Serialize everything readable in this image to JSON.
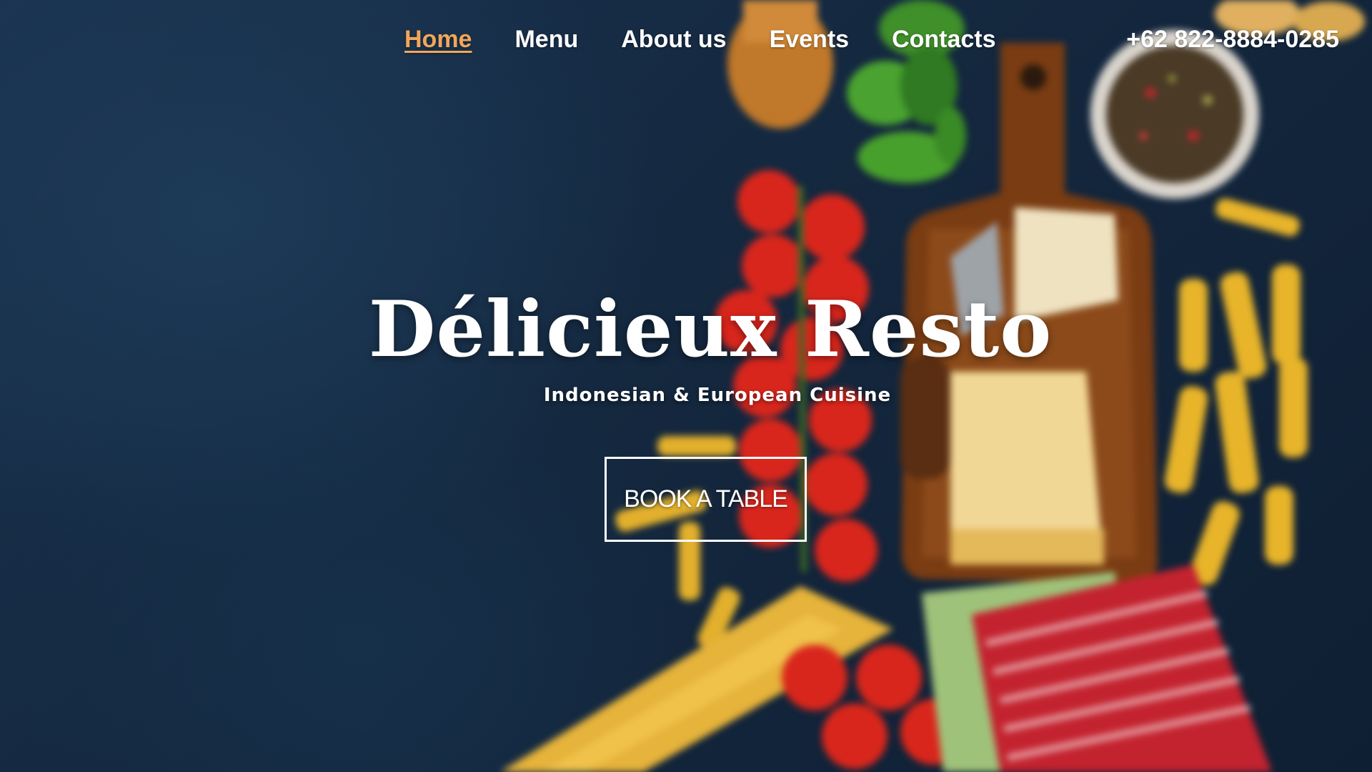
{
  "nav": {
    "items": [
      {
        "label": "Home",
        "active": true
      },
      {
        "label": "Menu",
        "active": false
      },
      {
        "label": "About us",
        "active": false
      },
      {
        "label": "Events",
        "active": false
      },
      {
        "label": "Contacts",
        "active": false
      }
    ],
    "phone": "+62 822-8884-0285"
  },
  "hero": {
    "title": "Délicieux Resto",
    "subtitle": "Indonesian & European Cuisine",
    "cta_label": "BOOK A TABLE"
  },
  "colors": {
    "active_nav": "#f2a65a",
    "background": "#14283f",
    "text": "#ffffff"
  },
  "icons": {
    "background": "food-background-image"
  }
}
